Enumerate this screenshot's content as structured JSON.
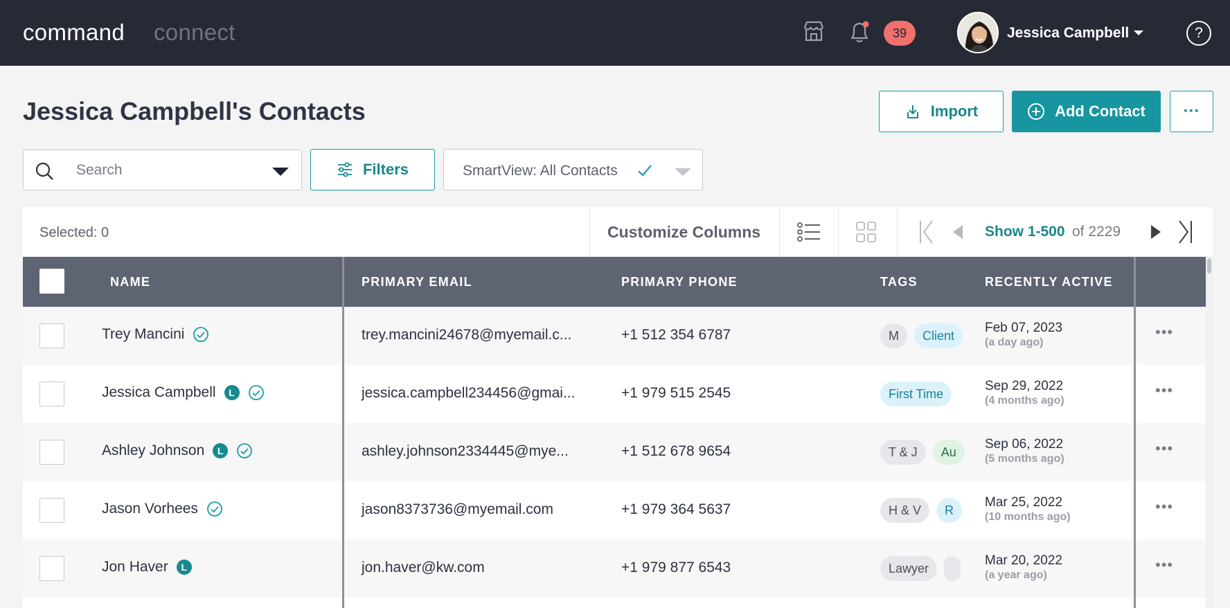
{
  "topbar": {
    "brand_primary": "command",
    "brand_secondary": "connect",
    "notification_count": "39",
    "user_name": "Jessica Campbell",
    "help_glyph": "?"
  },
  "header": {
    "title": "Jessica Campbell's Contacts",
    "import_label": "Import",
    "add_contact_label": "Add Contact",
    "more_label": "···"
  },
  "search": {
    "placeholder": "Search",
    "filters_label": "Filters",
    "smartview_label": "SmartView: All Contacts"
  },
  "toolbar": {
    "selected_label": "Selected: 0",
    "customize_label": "Customize Columns",
    "show_range": "Show 1-500",
    "of_total": "of 2229"
  },
  "columns": {
    "name": "NAME",
    "email": "PRIMARY EMAIL",
    "phone": "PRIMARY PHONE",
    "tags": "TAGS",
    "recent": "RECENTLY ACTIVE"
  },
  "rows": [
    {
      "name": "Trey Mancini",
      "lead": "",
      "verified": true,
      "email": "trey.mancini24678@myemail.c...",
      "phone": "+1 512 354 6787",
      "tags": [
        {
          "label": "M",
          "style": "gray"
        },
        {
          "label": "Client",
          "style": "blue"
        }
      ],
      "date": "Feb 07, 2023",
      "ago": "(a day ago)"
    },
    {
      "name": "Jessica Campbell",
      "lead": "L",
      "verified": true,
      "email": "jessica.campbell234456@gmai...",
      "phone": "+1 979 515 2545",
      "tags": [
        {
          "label": "First Time",
          "style": "blue"
        }
      ],
      "date": "Sep 29, 2022",
      "ago": "(4 months ago)"
    },
    {
      "name": "Ashley Johnson",
      "lead": "L",
      "verified": true,
      "email": "ashley.johnson2334445@mye...",
      "phone": "+1 512 678 9654",
      "tags": [
        {
          "label": "T & J",
          "style": "gray"
        },
        {
          "label": "Au",
          "style": "green"
        }
      ],
      "date": "Sep 06, 2022",
      "ago": "(5 months ago)"
    },
    {
      "name": "Jason Vorhees",
      "lead": "",
      "verified": true,
      "email": "jason8373736@myemail.com",
      "phone": "+1 979 364 5637",
      "tags": [
        {
          "label": "H & V",
          "style": "gray"
        },
        {
          "label": "R",
          "style": "blue"
        }
      ],
      "date": "Mar 25, 2022",
      "ago": "(10 months ago)"
    },
    {
      "name": "Jon Haver",
      "lead": "L",
      "verified": false,
      "email": "jon.haver@kw.com",
      "phone": "+1 979 877 6543",
      "tags": [
        {
          "label": "Lawyer",
          "style": "gray"
        },
        {
          "label": "",
          "style": "gray"
        }
      ],
      "date": "Mar 20, 2022",
      "ago": "(a year ago)"
    }
  ],
  "colors": {
    "topbar_bg": "#262a35",
    "accent": "#1795a0",
    "table_header_bg": "#5f6473",
    "badge": "#f0706c"
  },
  "icons": {
    "store": "store-icon",
    "bell": "bell-icon",
    "help": "help-icon",
    "import": "download-icon",
    "add": "plus-circle-icon",
    "filters": "sliders-icon",
    "check": "check-icon",
    "list_view": "list-view-icon",
    "grid_view": "grid-view-icon"
  }
}
